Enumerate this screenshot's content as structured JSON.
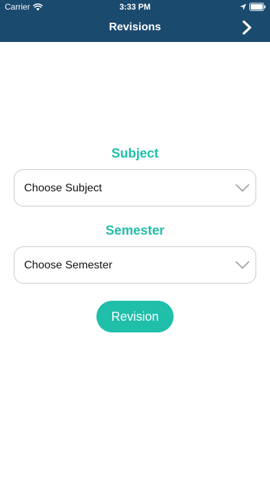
{
  "status_bar": {
    "carrier": "Carrier",
    "time": "3:33 PM",
    "icons": [
      "wifi-icon",
      "location-icon",
      "battery-icon"
    ]
  },
  "nav": {
    "title": "Revisions",
    "next_icon": "chevron-right-icon"
  },
  "form": {
    "subject_label": "Subject",
    "subject_value": "Choose Subject",
    "semester_label": "Semester",
    "semester_value": "Choose Semester",
    "submit_label": "Revision"
  },
  "colors": {
    "header_bg": "#1a4a6e",
    "accent": "#1fbfaa",
    "border": "#c8c8c8"
  }
}
